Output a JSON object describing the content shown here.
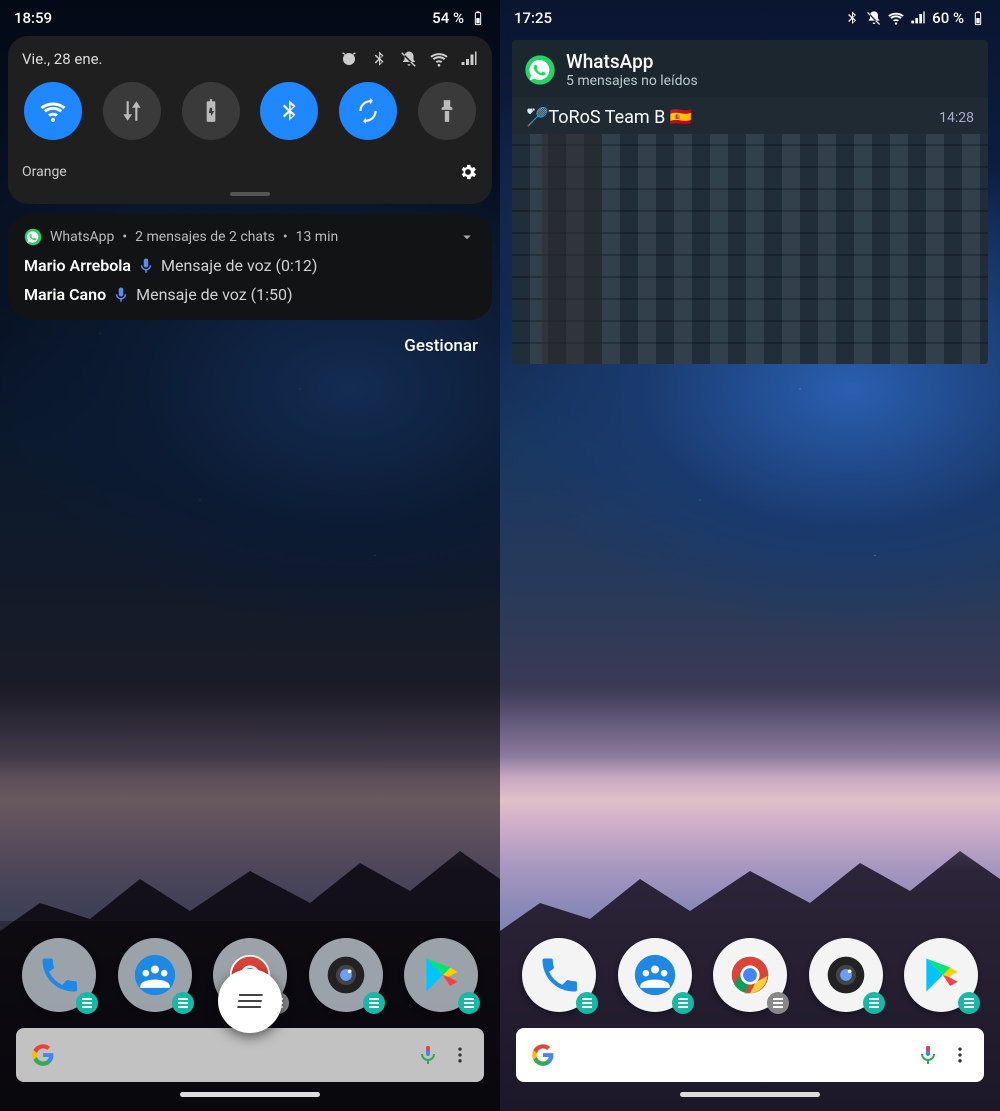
{
  "left": {
    "status": {
      "time": "18:59",
      "battery": "54 %"
    },
    "qs": {
      "date": "Vie., 28 ene.",
      "tiles": [
        {
          "name": "wifi",
          "active": true
        },
        {
          "name": "data",
          "active": false
        },
        {
          "name": "battery-saver",
          "active": false
        },
        {
          "name": "bluetooth",
          "active": true
        },
        {
          "name": "auto-rotate",
          "active": true
        },
        {
          "name": "flashlight",
          "active": false
        }
      ],
      "carrier": "Orange"
    },
    "notif": {
      "app": "WhatsApp",
      "summary": "2 mensajes de 2 chats",
      "age": "13 min",
      "lines": [
        {
          "sender": "Mario Arrebola",
          "body": "Mensaje de voz (0:12)"
        },
        {
          "sender": "Maria Cano",
          "body": "Mensaje de voz (1:50)"
        }
      ]
    },
    "manage": "Gestionar",
    "dock_apps": [
      "phone",
      "contacts",
      "chrome",
      "camera",
      "play-store"
    ]
  },
  "right": {
    "status": {
      "time": "17:25",
      "battery": "60 %"
    },
    "wa": {
      "app": "WhatsApp",
      "subtitle": "5 mensajes no leídos",
      "chat_name": "ToRoS Team B",
      "chat_emoji_prefix": "🏸",
      "chat_emoji_suffix": "🇪🇸",
      "chat_time": "14:28"
    },
    "dock_apps": [
      "phone",
      "contacts",
      "chrome",
      "camera",
      "play-store"
    ]
  }
}
